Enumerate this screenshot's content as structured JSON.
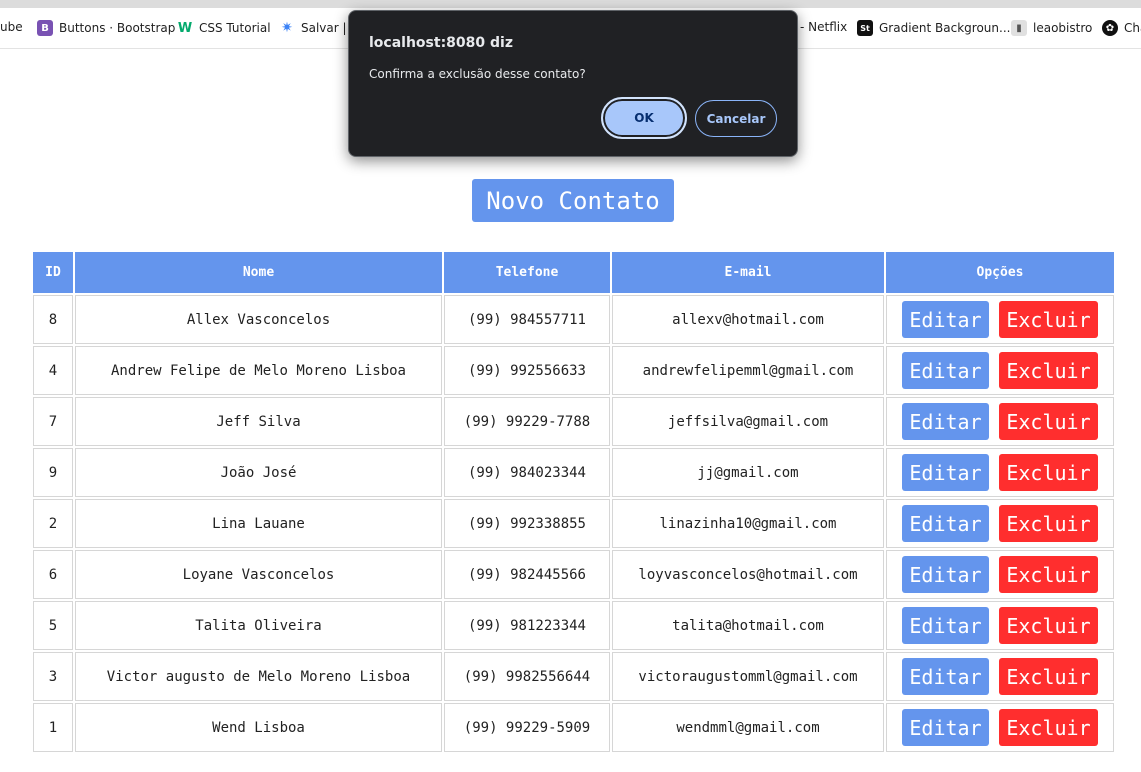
{
  "bookmarks": [
    {
      "label": "ube",
      "icon": "youtube-icon",
      "color": "#ff0000"
    },
    {
      "label": "Buttons · Bootstrap",
      "icon": "bootstrap-icon",
      "color": "#7952b3"
    },
    {
      "label": "CSS Tutorial",
      "icon": "w3schools-icon",
      "color": "#04aa6d"
    },
    {
      "label": "Salvar | V",
      "icon": "gear-icon",
      "color": "#3b82f6"
    },
    {
      "label": "- Netflix",
      "icon": "netflix-icon",
      "color": "#e50914"
    },
    {
      "label": "Gradient Backgroun...",
      "icon": "gradient-icon",
      "color": "#111111"
    },
    {
      "label": "leaobistro",
      "icon": "page-icon",
      "color": "#555555"
    },
    {
      "label": "Cha",
      "icon": "chatgpt-icon",
      "color": "#111111"
    }
  ],
  "dialog": {
    "title": "localhost:8080 diz",
    "message": "Confirma a exclusão desse contato?",
    "ok_label": "OK",
    "cancel_label": "Cancelar"
  },
  "new_contact_label": "Novo Contato",
  "table": {
    "headers": [
      "ID",
      "Nome",
      "Telefone",
      "E-mail",
      "Opções"
    ],
    "edit_label": "Editar",
    "delete_label": "Excluir",
    "rows": [
      {
        "id": "8",
        "nome": "Allex Vasconcelos",
        "telefone": "(99) 984557711",
        "email": "allexv@hotmail.com"
      },
      {
        "id": "4",
        "nome": "Andrew Felipe de Melo Moreno Lisboa",
        "telefone": "(99) 992556633",
        "email": "andrewfelipemml@gmail.com"
      },
      {
        "id": "7",
        "nome": "Jeff Silva",
        "telefone": "(99) 99229-7788",
        "email": "jeffsilva@gmail.com"
      },
      {
        "id": "9",
        "nome": "João José",
        "telefone": "(99) 984023344",
        "email": "jj@gmail.com"
      },
      {
        "id": "2",
        "nome": "Lina Lauane",
        "telefone": "(99) 992338855",
        "email": "linazinha10@gmail.com"
      },
      {
        "id": "6",
        "nome": "Loyane Vasconcelos",
        "telefone": "(99) 982445566",
        "email": "loyvasconcelos@hotmail.com"
      },
      {
        "id": "5",
        "nome": "Talita Oliveira",
        "telefone": "(99) 981223344",
        "email": "talita@hotmail.com"
      },
      {
        "id": "3",
        "nome": "Victor augusto de Melo Moreno Lisboa",
        "telefone": "(99) 9982556644",
        "email": "victoraugustomml@gmail.com"
      },
      {
        "id": "1",
        "nome": "Wend Lisboa",
        "telefone": "(99) 99229-5909",
        "email": "wendmml@gmail.com"
      }
    ]
  },
  "colors": {
    "accent": "#6495ed",
    "danger": "#ff2e2e",
    "dialog_bg": "#202124",
    "ok_bg": "#a8c7fa"
  }
}
